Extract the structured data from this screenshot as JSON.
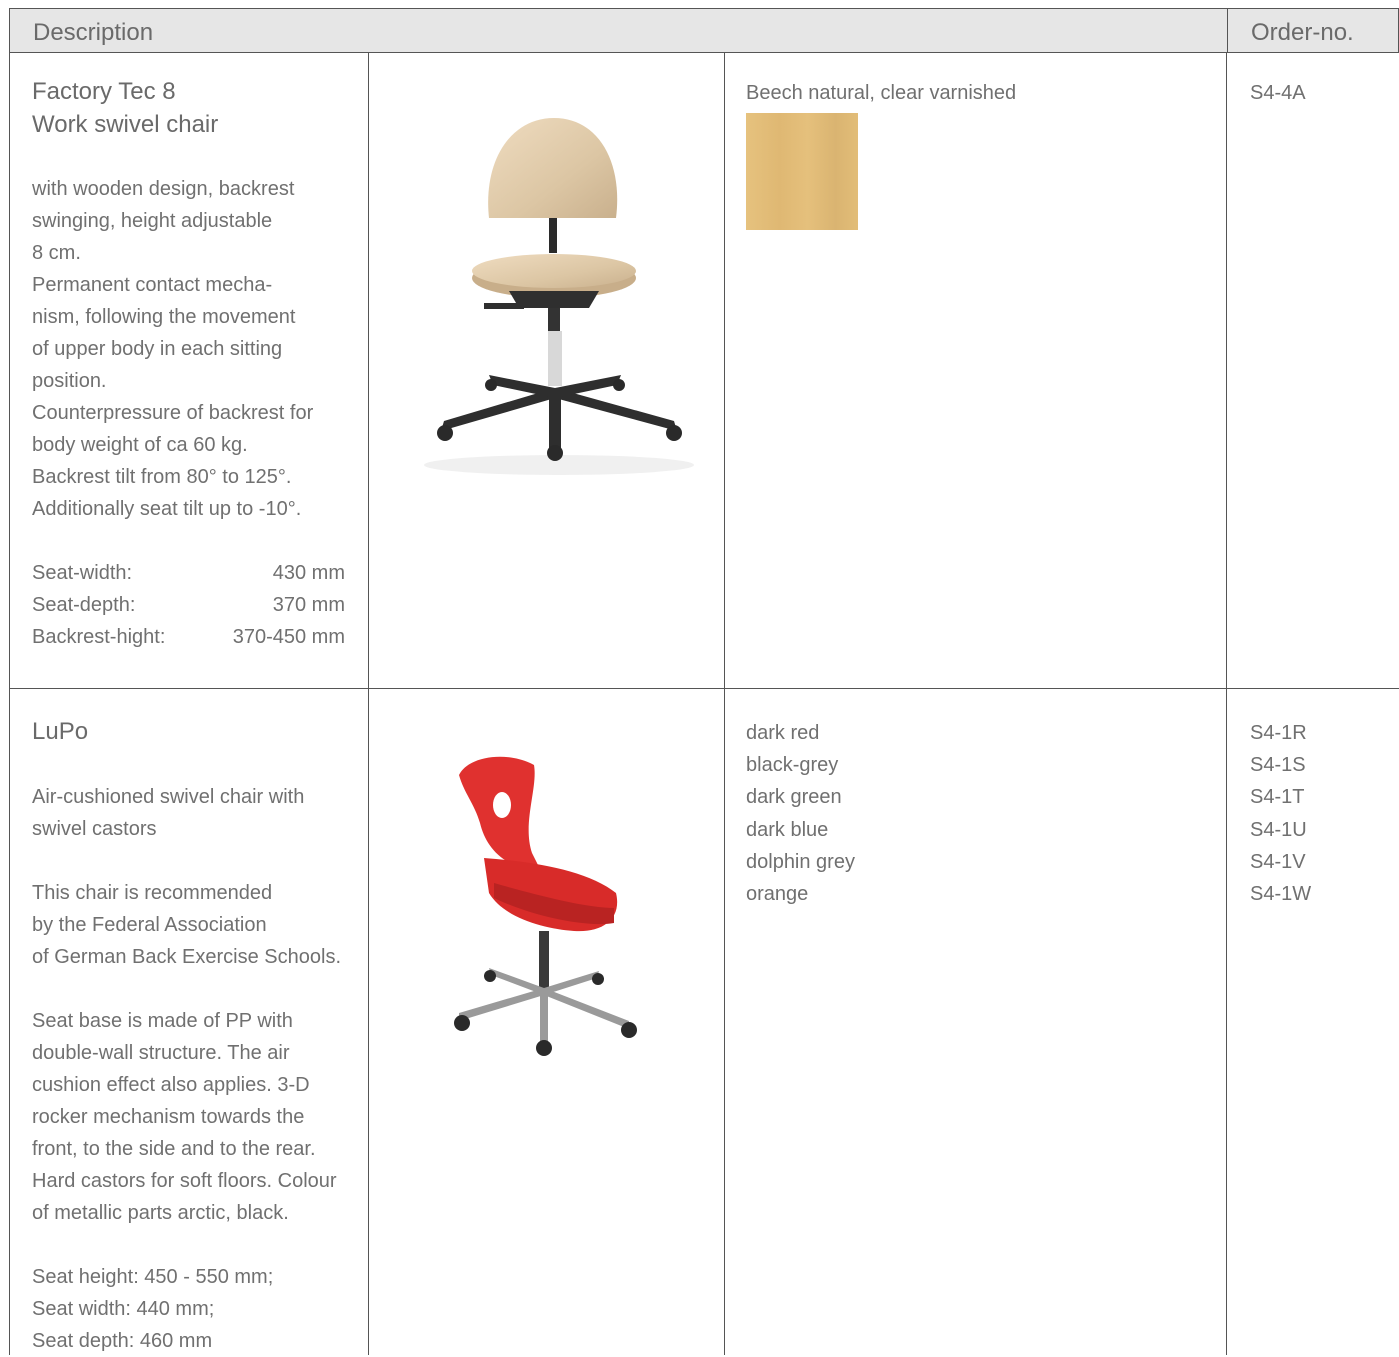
{
  "header": {
    "description_label": "Description",
    "order_label": "Order-no."
  },
  "products": [
    {
      "title_line1": "Factory Tec 8",
      "title_line2": "Work swivel chair",
      "description": "with wooden design, backrest\nswinging, height adjustable\n8 cm.\nPermanent contact mecha-\nnism, following the movement\nof upper body in each sitting\nposition.\nCounterpressure of backrest for\nbody weight of ca 60 kg.\nBackrest tilt from 80° to 125°.\nAdditionally seat tilt up to -10°.",
      "specs": [
        {
          "label": "Seat-width:",
          "value": "430 mm"
        },
        {
          "label": "Seat-depth:",
          "value": "370 mm"
        },
        {
          "label": "Backrest-hight:",
          "value": "370-450 mm"
        }
      ],
      "variants": [
        "Beech natural, clear varnished"
      ],
      "order_numbers": [
        "S4-4A"
      ],
      "swatch_color": "#e2bd78",
      "image_icon": "wooden-swivel-chair-image"
    },
    {
      "title_line1": "LuPo",
      "description": "Air-cushioned swivel chair with\nswivel castors\n\nThis chair is recommended\nby the Federal Association\nof German Back Exercise Schools.\n\nSeat base is made of PP with\ndouble-wall structure. The air\ncushion effect also applies. 3-D\nrocker mechanism towards the\nfront, to the side and to the rear.\nHard castors for soft floors. Colour\nof metallic parts arctic, black.\n\nSeat height: 450 - 550 mm;\nSeat width: 440 mm;\nSeat depth: 460 mm",
      "variants": [
        "dark red",
        "black-grey",
        "dark green",
        "dark blue",
        "dolphin grey",
        "orange"
      ],
      "order_numbers": [
        "S4-1R",
        "S4-1S",
        "S4-1T",
        "S4-1U",
        "S4-1V",
        "S4-1W"
      ],
      "seat_color": "#e0312f",
      "image_icon": "red-swivel-chair-image"
    }
  ]
}
